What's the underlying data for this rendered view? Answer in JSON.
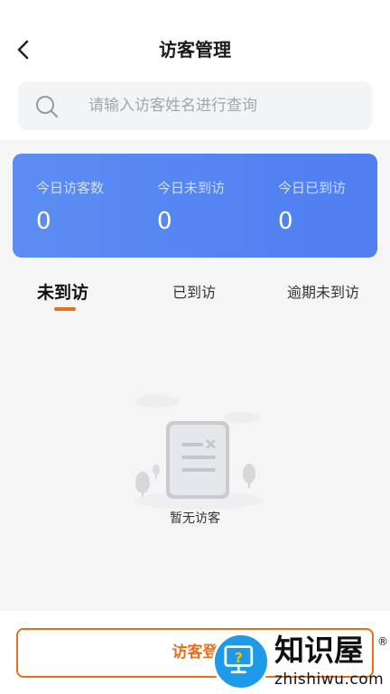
{
  "header": {
    "title": "访客管理",
    "back_icon": "chevron-left-icon"
  },
  "search": {
    "placeholder": "请输入访客姓名进行查询",
    "icon": "search-icon"
  },
  "stats": {
    "gradient_start": "#5b8df2",
    "gradient_end": "#4f7ef1",
    "items": [
      {
        "label": "今日访客数",
        "value": "0"
      },
      {
        "label": "今日未到访",
        "value": "0"
      },
      {
        "label": "今日已到访",
        "value": "0"
      }
    ]
  },
  "tabs": [
    {
      "label": "未到访",
      "active": true
    },
    {
      "label": "已到访",
      "active": false
    },
    {
      "label": "逾期未到访",
      "active": false
    }
  ],
  "accent_color": "#e8701d",
  "empty_state": {
    "text": "暂无访客",
    "icon": "empty-document-icon"
  },
  "bottom": {
    "register_label": "访客登"
  },
  "watermark": {
    "text": "知识屋",
    "registered": "®",
    "url": "zhishiwu.com",
    "icon": "monitor-question-icon"
  }
}
